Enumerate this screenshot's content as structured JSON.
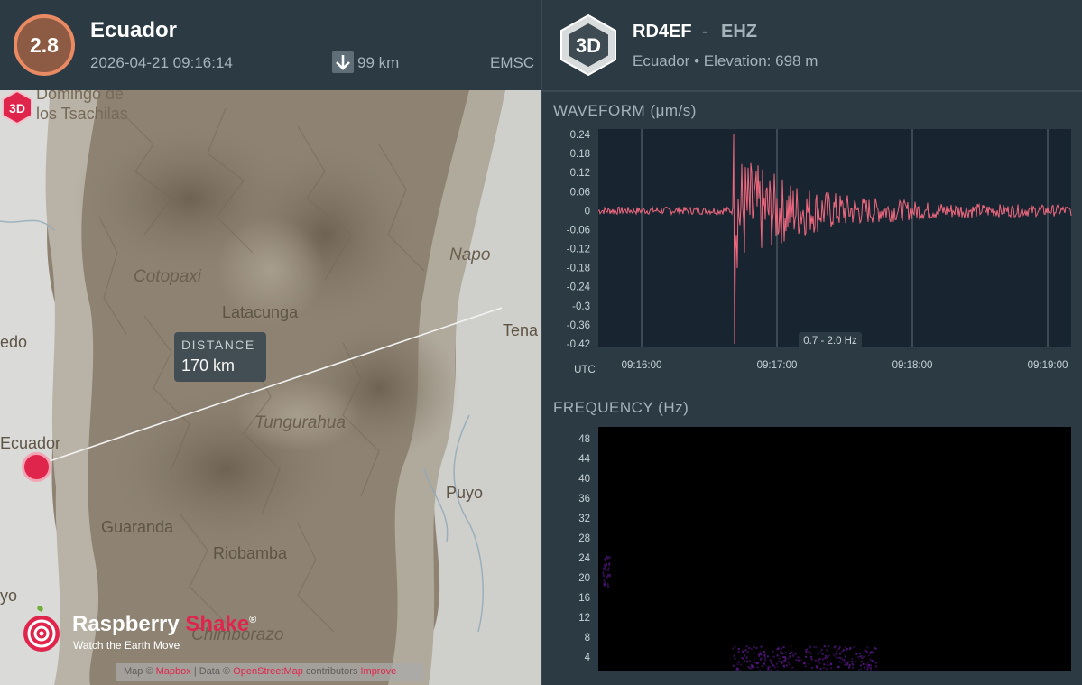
{
  "event": {
    "magnitude": "2.8",
    "region": "Ecuador",
    "datetime": "2026-04-21 09:16:14",
    "depth": "99 km",
    "source": "EMSC"
  },
  "map": {
    "labels": {
      "santo_domingo_1": "Domingo de",
      "santo_domingo_2": "los Tsachilas",
      "napo": "Napo",
      "cotopaxi": "Cotopaxi",
      "latacunga": "Latacunga",
      "tena": "Tena",
      "quevedo": "edo",
      "tungurahua": "Tungurahua",
      "ecuador": "Ecuador",
      "puyo": "Puyo",
      "guaranda": "Guaranda",
      "riobamba": "Riobamba",
      "babahoyo": "yo",
      "chimborazo": "Chimborazo"
    },
    "distance_label": "DISTANCE",
    "distance_value": "170 km",
    "station_marker_label": "3D",
    "brand_name_1": "Raspberry",
    "brand_name_2": "Shake",
    "brand_reg": "®",
    "brand_tagline": "Watch the Earth Move",
    "attribution": {
      "map_prefix": "Map ©",
      "map_link": "Mapbox",
      "data_prefix": "| Data ©",
      "data_link": "OpenStreetMap",
      "suffix": "contributors",
      "extra_link": "Improve"
    }
  },
  "station": {
    "badge": "3D",
    "id": "RD4EF",
    "separator": "-",
    "channel": "EHZ",
    "location": "Ecuador",
    "bullet": "•",
    "elevation": "Elevation: 698 m"
  },
  "waveform": {
    "title": "WAVEFORM",
    "unit": "(μm/s)",
    "y_ticks": [
      "0.24",
      "0.18",
      "0.12",
      "0.06",
      "0",
      "-0.06",
      "-0.12",
      "-0.18",
      "-0.24",
      "-0.3",
      "-0.36",
      "-0.42"
    ],
    "y_values": [
      0.24,
      0.18,
      0.12,
      0.06,
      0,
      -0.06,
      -0.12,
      -0.18,
      -0.24,
      -0.3,
      -0.36,
      -0.42
    ],
    "x_ticks": [
      "09:16:00",
      "09:17:00",
      "09:18:00",
      "09:19:00"
    ],
    "x_tz": "UTC",
    "filter": "0.7 - 2.0 Hz",
    "color": "#f0687f"
  },
  "frequency": {
    "title": "FREQUENCY",
    "unit": "(Hz)",
    "y_ticks": [
      "48",
      "44",
      "40",
      "36",
      "32",
      "28",
      "24",
      "20",
      "16",
      "12",
      "8",
      "4"
    ]
  },
  "colors": {
    "panel_bg": "#2c3a44",
    "plot_bg": "#182530",
    "magnitude_ring": "#e98a63",
    "magnitude_fill": "#8d5a44",
    "accent": "#e0254d"
  }
}
